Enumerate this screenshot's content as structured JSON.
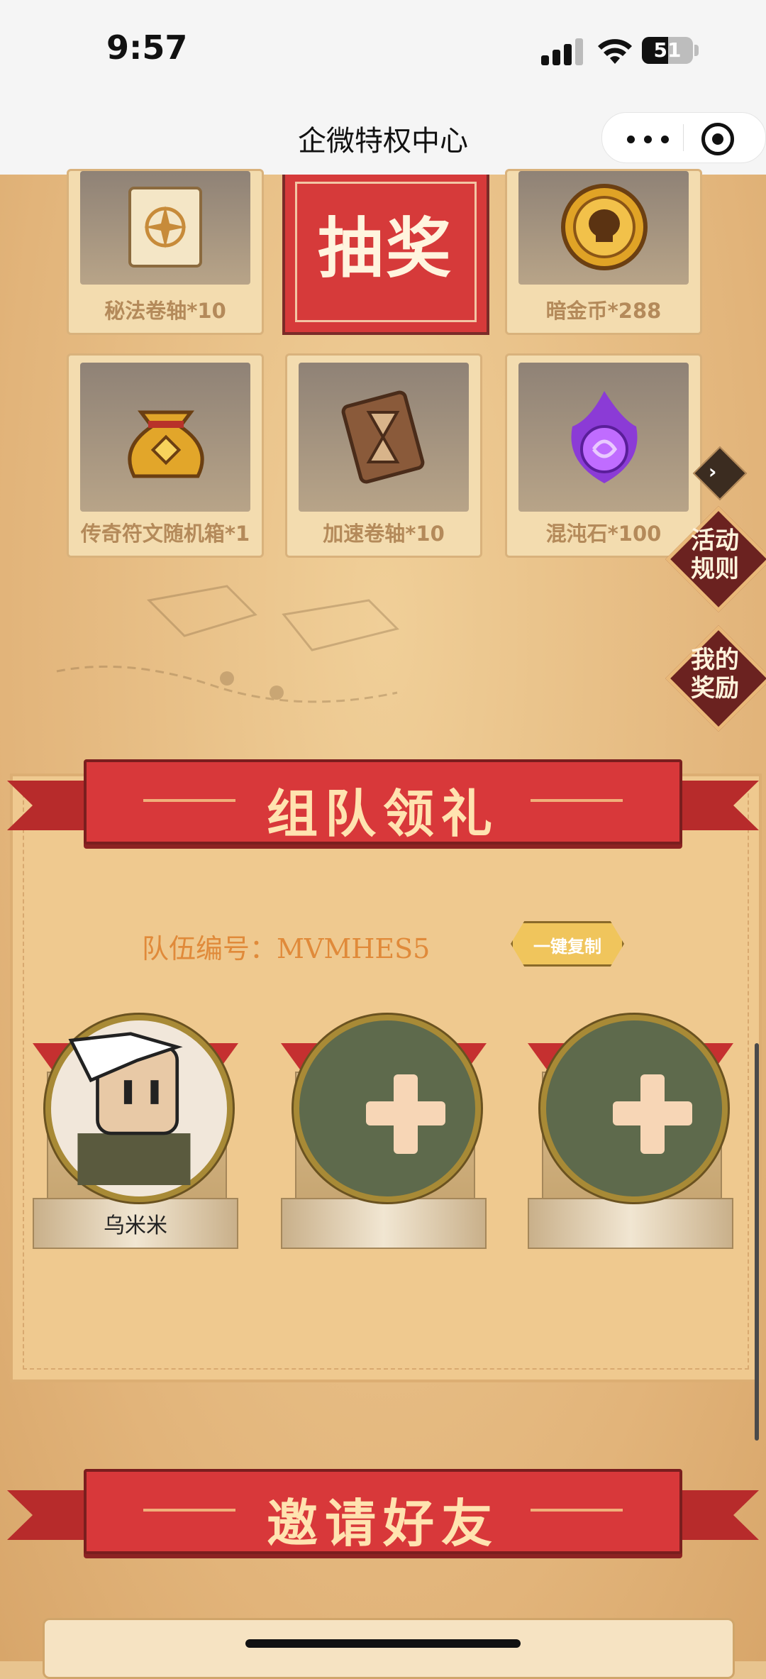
{
  "status_bar": {
    "time": "9:57",
    "battery": "51",
    "battery_fraction": 0.51
  },
  "navbar": {
    "title": "企微特权中心",
    "more_icon": "more-dots-icon",
    "close_icon": "target-icon"
  },
  "prizes": [
    {
      "label": "秘法卷轴*10",
      "icon": "scroll-icon"
    },
    {
      "label": "暗金币*288",
      "icon": "skull-coin-icon"
    },
    {
      "label": "传奇符文随机箱*1",
      "icon": "bag-icon"
    },
    {
      "label": "加速卷轴*10",
      "icon": "hourglass-scroll-icon"
    },
    {
      "label": "混沌石*100",
      "icon": "purple-flame-icon"
    }
  ],
  "lottery_label": "抽奖",
  "side_buttons": {
    "rules": "活动\n规则",
    "rewards": "我的\n奖励"
  },
  "team_section": {
    "title": "组队领礼",
    "team_label": "队伍编号：",
    "team_code": "MVMHES5",
    "copy_button": "一键复制",
    "members": [
      {
        "name": "乌米米",
        "filled": true
      },
      {
        "name": "",
        "filled": false
      },
      {
        "name": "",
        "filled": false
      }
    ]
  },
  "invite_section": {
    "title": "邀请好友"
  },
  "colors": {
    "ribbon_red": "#d8383a",
    "panel": "#efc98f",
    "team_code_orange": "#e08a3a"
  }
}
